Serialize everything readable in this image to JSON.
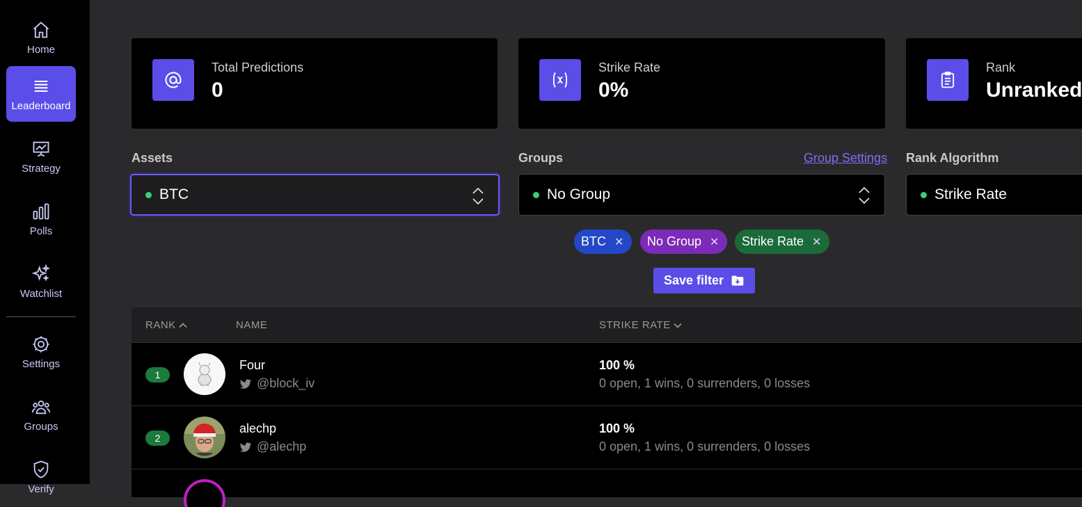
{
  "sidebar": {
    "items": [
      {
        "label": "Home",
        "icon": "home-icon"
      },
      {
        "label": "Leaderboard",
        "icon": "list-icon"
      },
      {
        "label": "Strategy",
        "icon": "presentation-chart-icon"
      },
      {
        "label": "Polls",
        "icon": "bar-chart-icon"
      },
      {
        "label": "Watchlist",
        "icon": "sparkles-icon"
      },
      {
        "label": "Settings",
        "icon": "gear-icon"
      },
      {
        "label": "Groups",
        "icon": "users-icon"
      },
      {
        "label": "Verify",
        "icon": "shield-check-icon"
      }
    ],
    "active": "Leaderboard"
  },
  "stats": {
    "total_predictions": {
      "label": "Total Predictions",
      "value": "0"
    },
    "strike_rate": {
      "label": "Strike Rate",
      "value": "0%"
    },
    "rank": {
      "label": "Rank",
      "value": "Unranked"
    }
  },
  "filters": {
    "assets": {
      "label": "Assets",
      "value": "BTC"
    },
    "groups": {
      "label": "Groups",
      "value": "No Group",
      "settings_link": "Group Settings"
    },
    "algorithm": {
      "label": "Rank Algorithm",
      "value": "Strike Rate"
    }
  },
  "chips": [
    {
      "label": "BTC",
      "color": "#2348c7"
    },
    {
      "label": "No Group",
      "color": "#7b2bb7"
    },
    {
      "label": "Strike Rate",
      "color": "#1b6b3a"
    }
  ],
  "save_filter_label": "Save filter",
  "table": {
    "columns": {
      "rank": "RANK",
      "name": "NAME",
      "strike_rate": "STRIKE RATE"
    },
    "rows": [
      {
        "rank": "1",
        "name": "Four",
        "handle": "@block_iv",
        "strike_rate": "100 %",
        "detail": "0 open, 1 wins, 0 surrenders, 0 losses"
      },
      {
        "rank": "2",
        "name": "alechp",
        "handle": "@alechp",
        "strike_rate": "100 %",
        "detail": "0 open, 1 wins, 0 surrenders, 0 losses"
      }
    ]
  },
  "colors": {
    "accent": "#5b4de8",
    "online": "#3bd16f"
  }
}
